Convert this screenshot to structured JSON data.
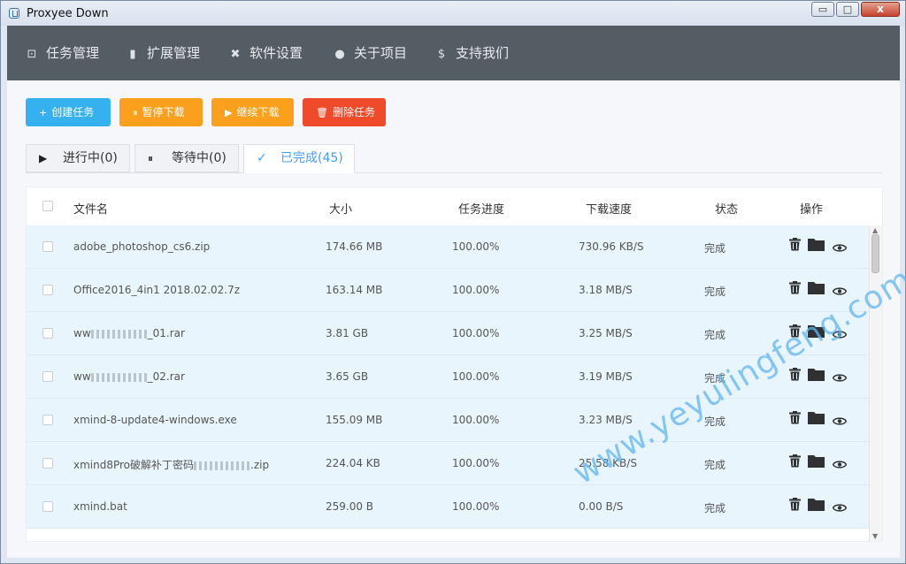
{
  "window": {
    "title": "Proxyee Down",
    "min_glyph": "▭",
    "max_glyph": "□",
    "close_glyph": "x"
  },
  "nav": {
    "items": [
      {
        "label": "任务管理",
        "icon": "task-icon",
        "glyph": "⊡"
      },
      {
        "label": "扩展管理",
        "icon": "extension-icon",
        "glyph": "▮"
      },
      {
        "label": "软件设置",
        "icon": "wrench-icon",
        "glyph": "✖"
      },
      {
        "label": "关于项目",
        "icon": "info-icon",
        "glyph": "●"
      },
      {
        "label": "支持我们",
        "icon": "dollar-icon",
        "glyph": "$"
      }
    ]
  },
  "toolbar": {
    "create": {
      "label": "创建任务",
      "glyph": "+"
    },
    "pause": {
      "label": "暂停下载",
      "glyph": "⏸"
    },
    "resume": {
      "label": "继续下载",
      "glyph": "▶"
    },
    "delete": {
      "label": "删除任务",
      "glyph": "🗑"
    }
  },
  "tabs": [
    {
      "label": "进行中(0)",
      "glyph": "▶"
    },
    {
      "label": "等待中(0)",
      "glyph": "⏸"
    },
    {
      "label": "已完成(45)",
      "glyph": "✓"
    }
  ],
  "table": {
    "headers": {
      "name": "文件名",
      "size": "大小",
      "progress": "任务进度",
      "speed": "下载速度",
      "status": "状态",
      "ops": "操作"
    },
    "rows": [
      {
        "name": "adobe_photoshop_cs6.zip",
        "size": "174.66 MB",
        "progress": "100.00%",
        "speed": "730.96 KB/S",
        "status": "完成"
      },
      {
        "name": "Office2016_4in1 2018.02.02.7z",
        "size": "163.14 MB",
        "progress": "100.00%",
        "speed": "3.18 MB/S",
        "status": "完成"
      },
      {
        "name_prefix": "ww",
        "name_suffix": "_01.rar",
        "size": "3.81 GB",
        "progress": "100.00%",
        "speed": "3.25 MB/S",
        "status": "完成"
      },
      {
        "name_prefix": "ww",
        "name_suffix": "_02.rar",
        "size": "3.65 GB",
        "progress": "100.00%",
        "speed": "3.19 MB/S",
        "status": "完成"
      },
      {
        "name": "xmind-8-update4-windows.exe",
        "size": "155.09 MB",
        "progress": "100.00%",
        "speed": "3.23 MB/S",
        "status": "完成"
      },
      {
        "name_prefix": "xmind8Pro破解补丁密码",
        "name_suffix": ".zip",
        "size": "224.04 KB",
        "progress": "100.00%",
        "speed": "25.58 KB/S",
        "status": "完成"
      },
      {
        "name": "xmind.bat",
        "size": "259.00 B",
        "progress": "100.00%",
        "speed": "0.00 B/S",
        "status": "完成"
      }
    ],
    "row_actions": [
      "trash-icon",
      "folder-icon",
      "eye-icon"
    ]
  },
  "watermark": "www.yeyulingfeng.com",
  "colors": {
    "nav_bg": "#545c64",
    "primary": "#36b1f0",
    "warning": "#fba01d",
    "danger": "#ef4a2a",
    "active_tab": "#409eff",
    "row_bg": "#e8f5fd"
  }
}
